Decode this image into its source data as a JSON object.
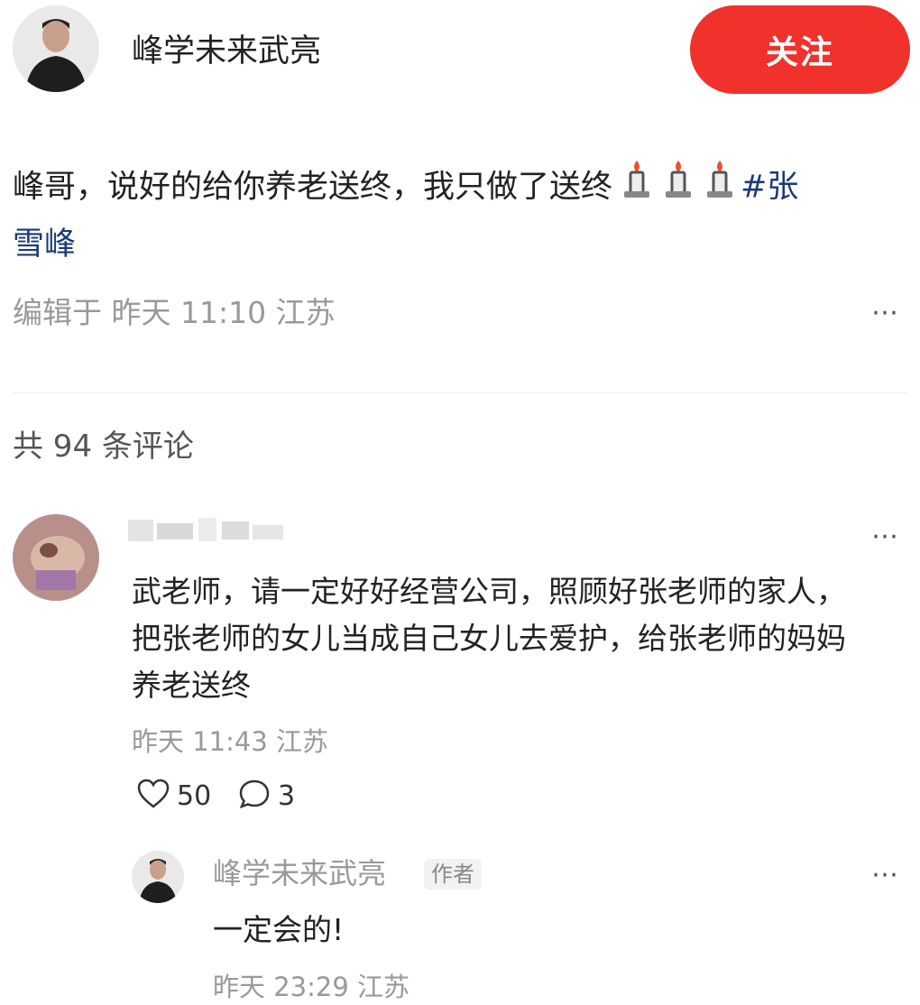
{
  "colors": {
    "accent": "#f0312c",
    "muted_text": "#999999",
    "divider": "#eeeeee",
    "blue_text": "#1a3a78"
  },
  "header": {
    "author_name": "峰学未来武亮",
    "follow_label": "关注"
  },
  "post": {
    "text_main": "峰哥，说好的给你养老送终，我只做了送终",
    "candles": [
      "candle-icon",
      "candle-icon",
      "candle-icon"
    ],
    "hashtag_part1": "#张",
    "hashtag_part2": "雪峰",
    "meta": "编辑于 昨天 11:10 江苏"
  },
  "comments_header": {
    "label": "共 94 条评论"
  },
  "comments": [
    {
      "body": [
        "武老师，请一定好好经营公司，照顾好张老师的家人，",
        "把张老师的女儿当成自己女儿去爱护，给张老师的妈妈",
        "养老送终"
      ],
      "meta": "昨天 11:43 江苏",
      "likes": "50",
      "replies": "3"
    }
  ],
  "reply": {
    "author": "峰学未来武亮",
    "badge": "作者",
    "body": "一定会的!",
    "meta": "昨天 23:29 江苏"
  }
}
